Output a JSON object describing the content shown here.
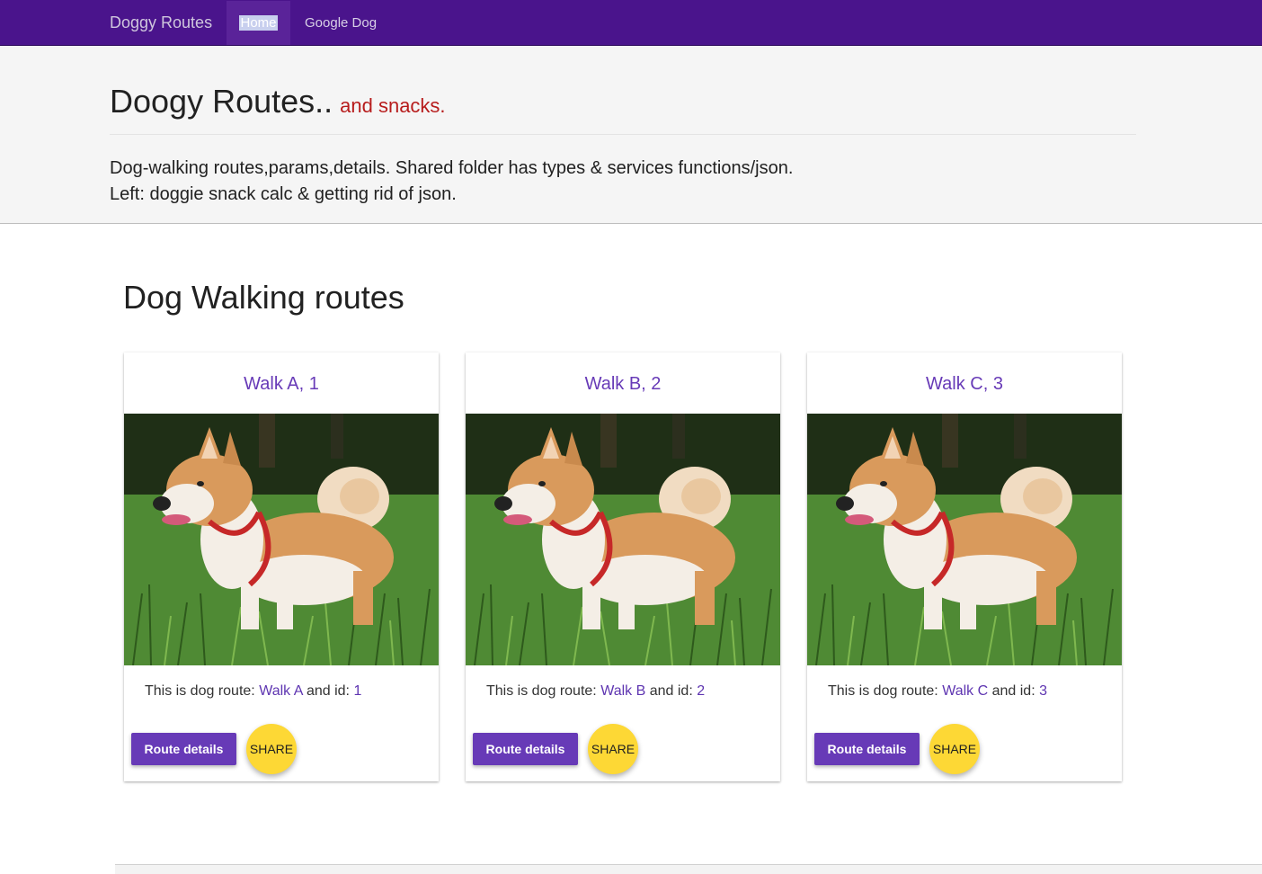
{
  "navbar": {
    "brand": "Doggy Routes",
    "items": [
      {
        "label": "Home"
      },
      {
        "label": "Google Dog"
      }
    ]
  },
  "jumbotron": {
    "title": "Doogy Routes..",
    "subtitle": "and snacks.",
    "line1": "Dog-walking routes,params,details. Shared folder has types & services functions/json.",
    "line2": "Left: doggie snack calc & getting rid of json."
  },
  "section": {
    "title": "Dog Walking routes"
  },
  "cards": [
    {
      "title": "Walk A, 1",
      "text_prefix": "This is dog route:",
      "route": "Walk A",
      "text_mid": "and id:",
      "id": "1",
      "details_label": "Route details",
      "share_label": "SHARE"
    },
    {
      "title": "Walk B, 2",
      "text_prefix": "This is dog route:",
      "route": "Walk B",
      "text_mid": "and id:",
      "id": "2",
      "details_label": "Route details",
      "share_label": "SHARE"
    },
    {
      "title": "Walk C, 3",
      "text_prefix": "This is dog route:",
      "route": "Walk C",
      "text_mid": "and id:",
      "id": "3",
      "details_label": "Route details",
      "share_label": "SHARE"
    }
  ],
  "colors": {
    "navbar": "#4a148c",
    "accent": "#673ab7",
    "share": "#fdd835",
    "subtitle": "#b71c1c"
  }
}
